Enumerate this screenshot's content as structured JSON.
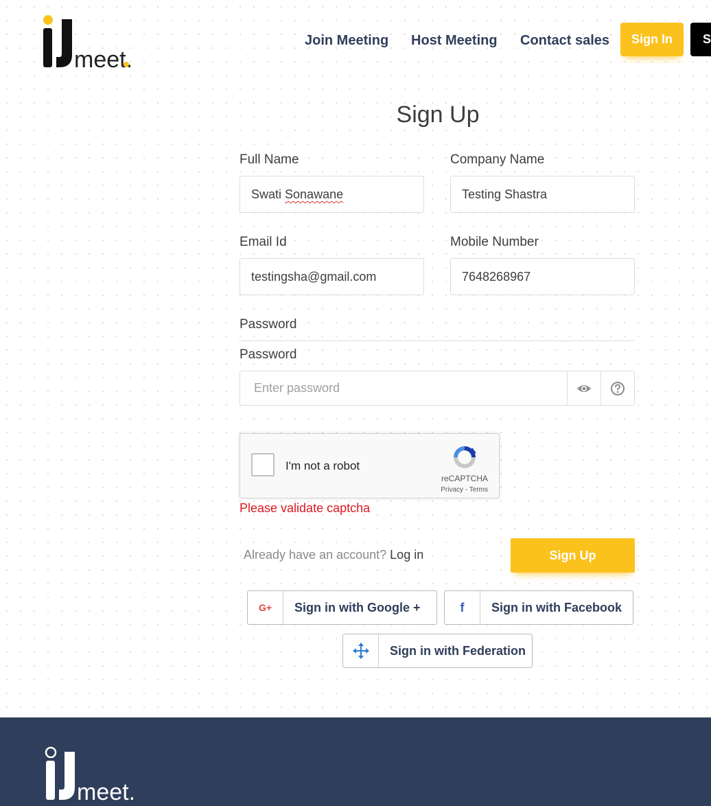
{
  "header": {
    "logo_text": "meet.",
    "nav": [
      "Join Meeting",
      "Host Meeting",
      "Contact sales"
    ],
    "signin_label": "Sign In",
    "signup_label": "S"
  },
  "form": {
    "title": "Sign Up",
    "full_name_label": "Full Name",
    "full_name_first": "Swati",
    "full_name_last": "Sonawane",
    "company_label": "Company Name",
    "company_value": "Testing Shastra",
    "email_label": "Email Id",
    "email_value": "testingsha@gmail.com",
    "mobile_label": "Mobile Number",
    "mobile_value": "7648268967",
    "password_label_1": "Password",
    "password_label_2": "Password",
    "password_placeholder": "Enter password",
    "captcha_text": "I'm not a robot",
    "captcha_brand": "reCAPTCHA",
    "captcha_privacy": "Privacy",
    "captcha_sep": " - ",
    "captcha_terms": "Terms",
    "captcha_error": "Please validate captcha",
    "already_text": "Already have an account?",
    "login_link": "Log in",
    "submit_label": "Sign Up"
  },
  "social": {
    "google_label": "Sign in with Google +",
    "google_icon_text": "G+",
    "facebook_label": "Sign in with Facebook",
    "facebook_icon_text": "f",
    "federation_label": "Sign in with Federation"
  },
  "footer": {
    "logo_text": "meet."
  },
  "colors": {
    "accent": "#fbc11d",
    "navy": "#2f3e5a",
    "error": "#d9181f"
  }
}
